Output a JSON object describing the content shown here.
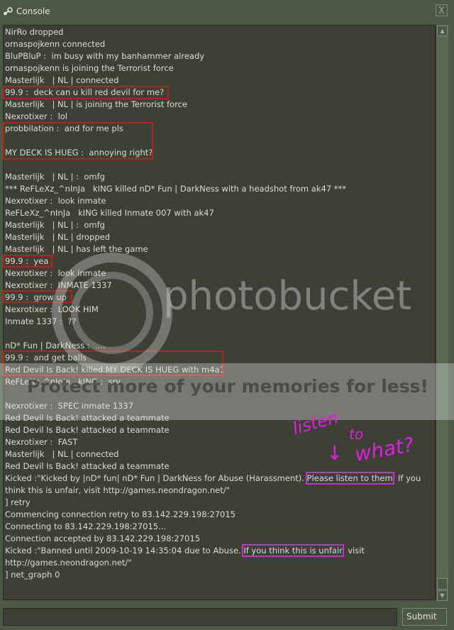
{
  "window": {
    "title": "Console",
    "icon": "steam-icon",
    "close_label": "X"
  },
  "console": {
    "lines": [
      [
        {
          "t": "NirRo dropped"
        }
      ],
      [
        {
          "t": "ornaspojkenn connected"
        }
      ],
      [
        {
          "t": "BluPBluP :  im busy with my banhammer already"
        }
      ],
      [
        {
          "t": "ornaspojkenn is joining the Terrorist force"
        }
      ],
      [
        {
          "t": "Masterlijk   | NL | connected"
        }
      ],
      [
        {
          "t": "99.9 :  deck can u kill red devil for me?"
        }
      ],
      [
        {
          "t": "Masterlijk   | NL | is joining the Terrorist force"
        }
      ],
      [
        {
          "t": "Nexrotixer :  lol"
        }
      ],
      [
        {
          "t": "probbilation :  and for me pls"
        }
      ],
      [
        {
          "t": ""
        }
      ],
      [
        {
          "t": "MY DECK IS HUEG :  annoying right?"
        }
      ],
      [
        {
          "t": ""
        }
      ],
      [
        {
          "t": "Masterlijk   | NL | :  omfg"
        }
      ],
      [
        {
          "t": "*** ReFLeXz_^nInJa   kING killed nD* Fun | DarkNess with a headshot from ak47 ***"
        }
      ],
      [
        {
          "t": "Nexrotixer :  look inmate"
        }
      ],
      [
        {
          "t": "ReFLeXz_^nInJa   kING killed Inmate 007 with ak47"
        }
      ],
      [
        {
          "t": "Masterlijk   | NL | :  omfg"
        }
      ],
      [
        {
          "t": "Masterlijk   | NL | dropped"
        }
      ],
      [
        {
          "t": "Masterlijk   | NL | has left the game"
        }
      ],
      [
        {
          "t": "99.9 :  yea"
        }
      ],
      [
        {
          "t": "Nexrotixer :  look inmate"
        }
      ],
      [
        {
          "t": "Nexrotixer :  INMATE 1337"
        }
      ],
      [
        {
          "t": "99.9 :  grow up"
        }
      ],
      [
        {
          "t": "Nexrotixer :  LOOK HIM"
        }
      ],
      [
        {
          "t": "Inmate 1337 :  ??"
        }
      ],
      [
        {
          "t": ""
        }
      ],
      [
        {
          "t": "nD* Fun | DarkNess :  ...."
        }
      ],
      [
        {
          "t": "99.9 :  and get balls"
        }
      ],
      [
        {
          "t": "Red Devil Is Back! killed MY DECK IS HUEG with m4a1"
        }
      ],
      [
        {
          "t": "ReFLeXz_^nInJa   kING :  sry"
        }
      ],
      [
        {
          "t": ""
        }
      ],
      [
        {
          "t": "Nexrotixer :  SPEC inmate 1337"
        }
      ],
      [
        {
          "t": "Red Devil Is Back! attacked a teammate"
        }
      ],
      [
        {
          "t": "Red Devil Is Back! attacked a teammate"
        }
      ],
      [
        {
          "t": "Nexrotixer :  FAST"
        }
      ],
      [
        {
          "t": "Masterlijk   | NL | connected"
        }
      ],
      [
        {
          "t": "Red Devil Is Back! attacked a teammate"
        }
      ],
      [
        {
          "t": "Kicked :\"Kicked by |nD* fun| nD* Fun | DarkNess for Abuse (Harassment). "
        },
        {
          "t": "Please listen to them",
          "hl": true
        },
        {
          "t": "  If you"
        }
      ],
      [
        {
          "t": "think this is unfair, visit http://games.neondragon.net/\""
        }
      ],
      [
        {
          "t": "] retry"
        }
      ],
      [
        {
          "t": "Commencing connection retry to 83.142.229.198:27015"
        }
      ],
      [
        {
          "t": "Connecting to 83.142.229.198:27015..."
        }
      ],
      [
        {
          "t": "Connection accepted by 83.142.229.198:27015"
        }
      ],
      [
        {
          "t": "Kicked :\"Banned until 2009-10-19 14:35:04 due to Abuse. "
        },
        {
          "t": "If you think this is unfair",
          "hl": true
        },
        {
          "t": "  visit"
        }
      ],
      [
        {
          "t": "http://games.neondragon.net/\""
        }
      ],
      [
        {
          "t": "] net_graph 0"
        }
      ]
    ]
  },
  "input": {
    "value": "",
    "placeholder": ""
  },
  "submit_label": "Submit",
  "watermark": {
    "logo_text": "photobucket",
    "banner": "Protect more of your memories for less!"
  },
  "annotation": {
    "line1": "listen",
    "line2": "to",
    "line3": "what?",
    "arrow": "↓"
  },
  "colors": {
    "frame": "#4c5844",
    "console_bg": "#3e4037",
    "text": "#d9ddd2",
    "red_box": "#c21c1c",
    "magenta": "#c830c8"
  }
}
